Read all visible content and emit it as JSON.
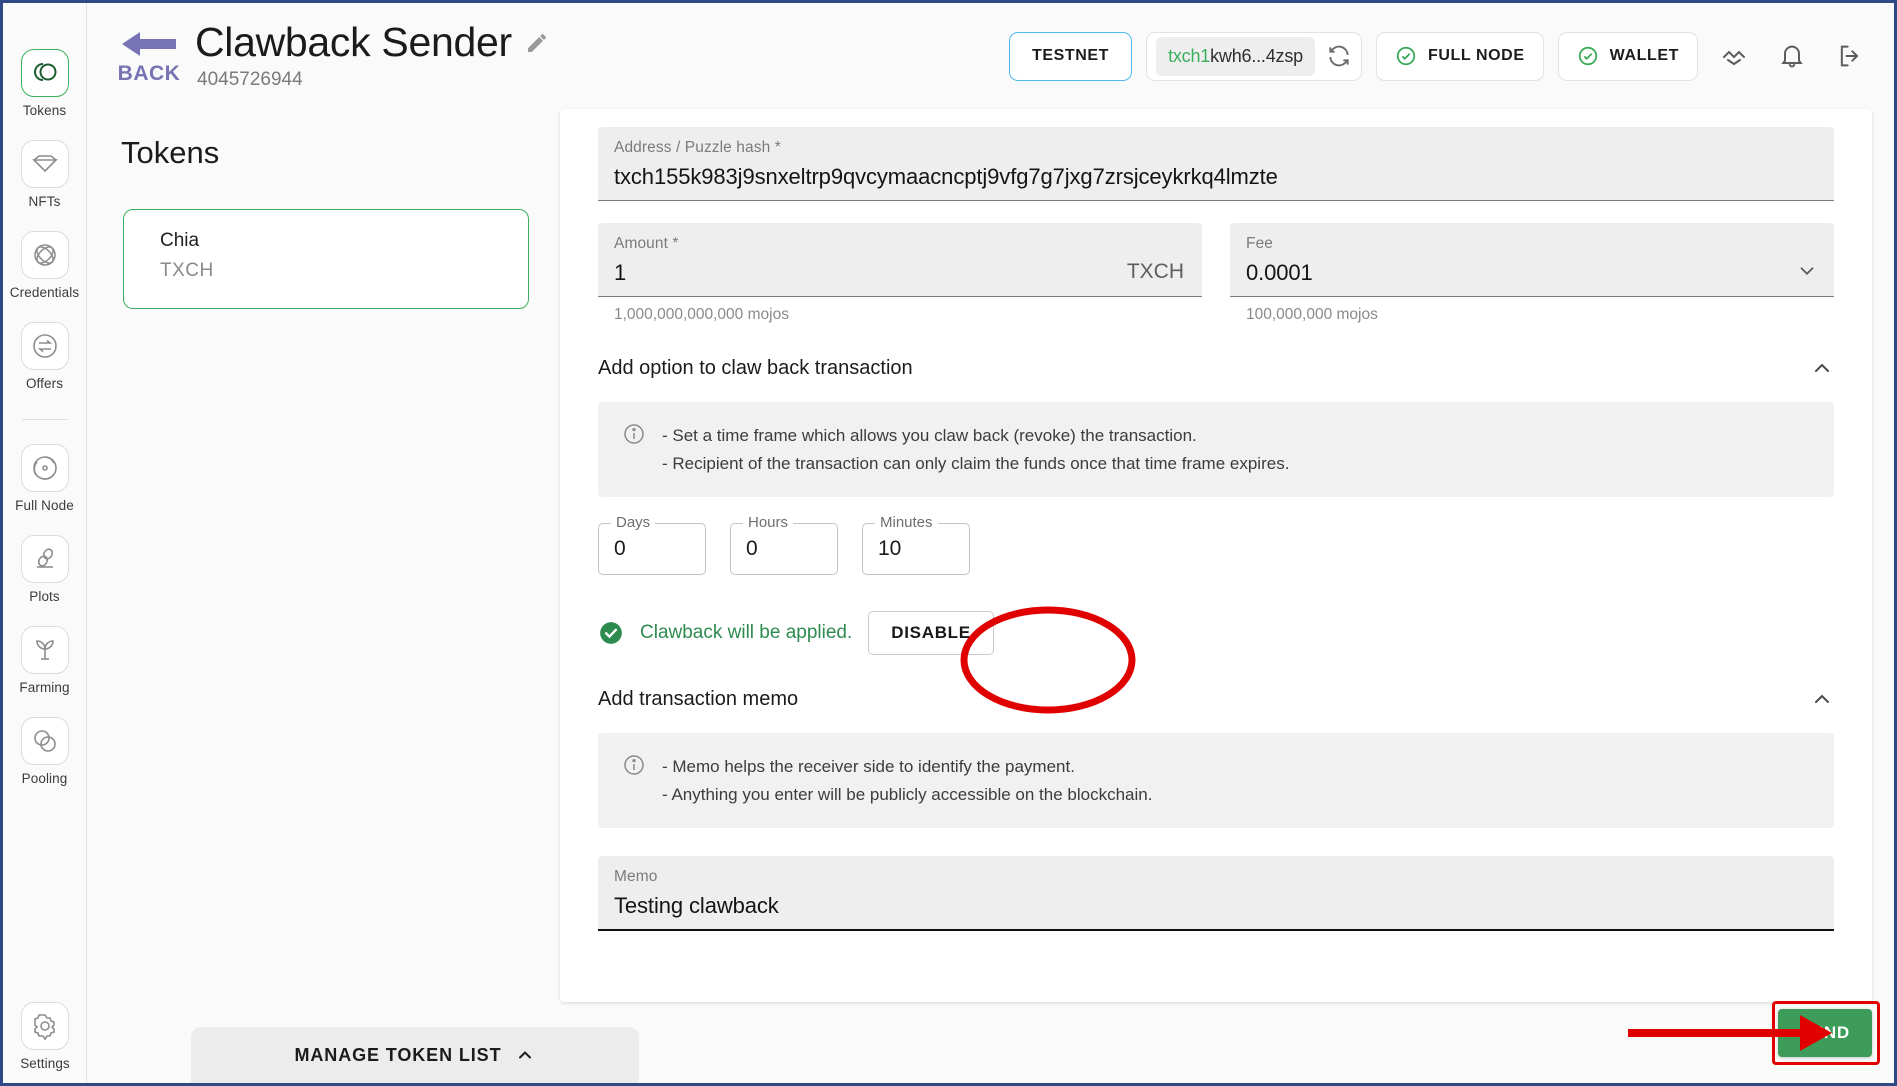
{
  "sidebar": {
    "items": [
      {
        "label": "Tokens",
        "icon": "tokens-icon",
        "active": true
      },
      {
        "label": "NFTs",
        "icon": "nft-diamond-icon",
        "active": false
      },
      {
        "label": "Credentials",
        "icon": "credentials-icon",
        "active": false
      },
      {
        "label": "Offers",
        "icon": "offers-swap-icon",
        "active": false
      },
      {
        "label": "Full Node",
        "icon": "full-node-icon",
        "active": false
      },
      {
        "label": "Plots",
        "icon": "plots-seed-icon",
        "active": false
      },
      {
        "label": "Farming",
        "icon": "farming-leaf-icon",
        "active": false
      },
      {
        "label": "Pooling",
        "icon": "pooling-links-icon",
        "active": false
      }
    ],
    "settings": {
      "label": "Settings",
      "icon": "gear-icon"
    }
  },
  "header": {
    "back_label": "BACK",
    "title": "Clawback Sender",
    "fingerprint": "4045726944",
    "network_chip": "TESTNET",
    "address_prefix": "txch1",
    "address_short": "kwh6...4zsp",
    "full_node_status": "FULL NODE",
    "wallet_status": "WALLET"
  },
  "left_pane": {
    "title": "Tokens",
    "token": {
      "name": "Chia",
      "symbol": "TXCH"
    },
    "manage_label": "MANAGE TOKEN LIST"
  },
  "form": {
    "address": {
      "label": "Address / Puzzle hash *",
      "value": "txch155k983j9snxeltrp9qvcymaacncptj9vfg7g7jxg7zrsjceykrkq4lmzte"
    },
    "amount": {
      "label": "Amount *",
      "value": "1",
      "unit": "TXCH",
      "helper": "1,000,000,000,000  mojos"
    },
    "fee": {
      "label": "Fee",
      "value": "0.0001",
      "helper": "100,000,000  mojos"
    },
    "clawback": {
      "section_title": "Add option to claw back transaction",
      "info_line_1": "- Set a time frame which allows you claw back (revoke) the transaction.",
      "info_line_2": "- Recipient of the transaction can only claim the funds once that time frame expires.",
      "days_label": "Days",
      "days_value": "0",
      "hours_label": "Hours",
      "hours_value": "0",
      "minutes_label": "Minutes",
      "minutes_value": "10",
      "status_text": "Clawback will be applied.",
      "disable_label": "DISABLE"
    },
    "memo_section": {
      "section_title": "Add transaction memo",
      "info_line_1": "- Memo helps the receiver side to identify the payment.",
      "info_line_2": "- Anything you enter will be publicly accessible on the blockchain.",
      "label": "Memo",
      "value": "Testing clawback"
    },
    "send_label": "SEND"
  },
  "colors": {
    "accent_green": "#3aaf5c",
    "send_green": "#3d9c5a",
    "annotation_red": "#e00000",
    "testnet_blue": "#52b8ec",
    "back_purple": "#7873b3"
  }
}
